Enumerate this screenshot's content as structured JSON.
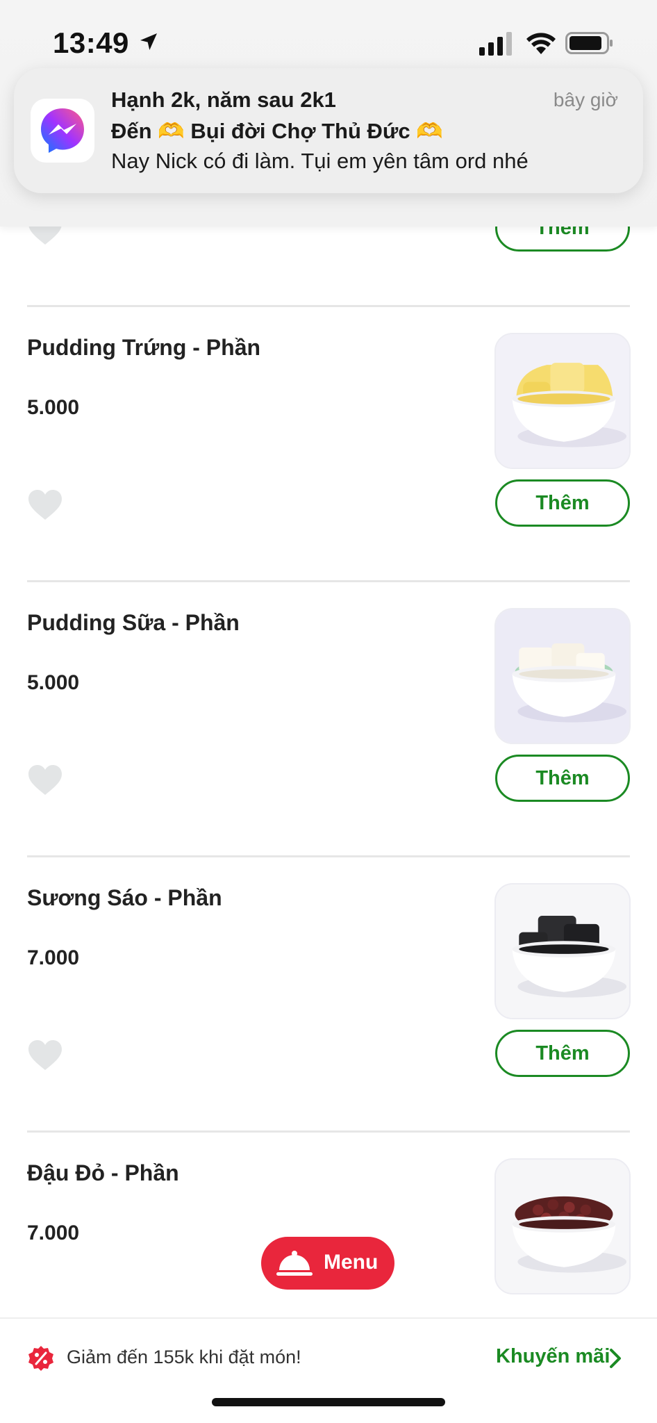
{
  "status_bar": {
    "time": "13:49",
    "icons": [
      "location-arrow-icon",
      "cellular-signal-icon",
      "wifi-icon",
      "battery-icon"
    ]
  },
  "notification": {
    "app_icon": "messenger-icon",
    "title": "Hạnh 2k, năm sau 2k1",
    "time": "bây giờ",
    "subtitle": "Đến 🫶 Bụi đời Chợ Thủ Đức 🫶",
    "body": "Nay Nick có đi làm. Tụi em yên tâm ord nhé"
  },
  "items": [
    {
      "name": "",
      "price": "",
      "add_label": "Thêm"
    },
    {
      "name": "Pudding Trứng - Phần",
      "price": "5.000",
      "add_label": "Thêm",
      "image": "egg-pudding-bowl"
    },
    {
      "name": "Pudding Sữa - Phần",
      "price": "5.000",
      "add_label": "Thêm",
      "image": "milk-pudding-bowl"
    },
    {
      "name": "Sương Sáo - Phần",
      "price": "7.000",
      "add_label": "Thêm",
      "image": "grass-jelly-bowl"
    },
    {
      "name": "Đậu Đỏ - Phần",
      "price": "7.000",
      "add_label": "Thêm",
      "image": "red-bean-bowl"
    }
  ],
  "menu_button": {
    "label": "Menu",
    "icon": "cloche-icon"
  },
  "promo_bar": {
    "icon": "discount-icon",
    "text": "Giảm đến 155k khi đặt món!",
    "link_label": "Khuyến mãi",
    "link_icon": "chevron-right-icon"
  },
  "colors": {
    "accent_green": "#1b8a23",
    "menu_red": "#e9263c",
    "heart_gray": "#e3e5e6"
  }
}
